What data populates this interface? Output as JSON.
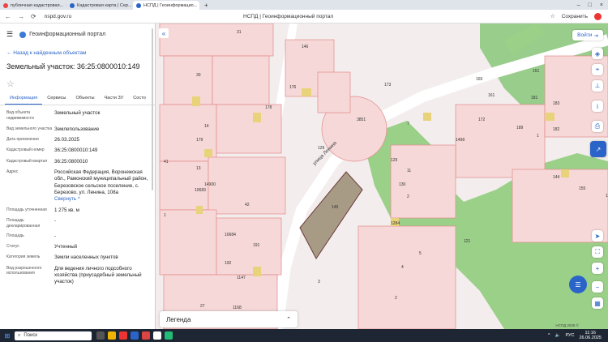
{
  "browser": {
    "tabs": [
      {
        "title": "публичная кадастровая...",
        "color": "#e44"
      },
      {
        "title": "Кадастровая карта | Сер...",
        "color": "#2a64c8"
      },
      {
        "title": "НСПД | Геоинформацио...",
        "color": "#2a64c8",
        "active": true
      }
    ],
    "new_tab": "+",
    "url": "nspd.gov.ru",
    "page_title": "НСПД | Геоинформационный портал",
    "save_label": "Сохранить",
    "nav": {
      "back": "←",
      "forward": "→",
      "reload": "⟳",
      "home": "⌂"
    }
  },
  "sidebar": {
    "portal_name": "Геоинформационный портал",
    "back_link": "← Назад к найденным объектам",
    "title": "Земельный участок: 36:25:0800010:149",
    "tabs": [
      "Информация",
      "Сервисы",
      "Объекты",
      "Части ЗУ",
      "Состо"
    ],
    "rows": [
      {
        "k": "Вид объекта недвижимости",
        "v": "Земельный участок"
      },
      {
        "k": "Вид земельного участка",
        "v": "Землепользование"
      },
      {
        "k": "Дата присвоения",
        "v": "26.03.2025"
      },
      {
        "k": "Кадастровый номер",
        "v": "36:25:0800010:149"
      },
      {
        "k": "Кадастровый квартал",
        "v": "36:25:0800010"
      },
      {
        "k": "Адрес",
        "v": "Российская Федерация, Воронежская обл., Рамонский муниципальный район, Березовское сельское поселение, с. Березово, ул. Ленина, 108а"
      },
      {
        "k": "Площадь уточненная",
        "v": "1 275 кв. м"
      },
      {
        "k": "Площадь декларированная",
        "v": "-"
      },
      {
        "k": "Площадь",
        "v": "-"
      },
      {
        "k": "Статус",
        "v": "Учтенный"
      },
      {
        "k": "Категория земель",
        "v": "Земли населенных пунктов"
      },
      {
        "k": "Вид разрешенного использования",
        "v": "Для ведения личного подсобного хозяйства (приусадебный земельный участок)"
      }
    ],
    "collapse_link": "Свернуть ^"
  },
  "map": {
    "login_label": "Войти",
    "legend_label": "Легенда",
    "copyright": "НСПД 2025 ©",
    "street_label": "улица Ленина",
    "plot_numbers": [
      "31",
      "30",
      "146",
      "176",
      "178",
      "179",
      "14",
      "13",
      "41",
      "14900",
      "10683",
      "1",
      "42",
      "10684",
      "191",
      "192",
      "129",
      "27",
      "1168",
      "149",
      "3851",
      "173",
      "7",
      "129",
      "11",
      "130",
      "2",
      "5",
      "4",
      "8",
      "3",
      "2",
      "151",
      "1",
      "144",
      "155",
      "156",
      "12",
      "161",
      "165",
      "172",
      "183",
      "182",
      "181",
      "1498",
      "189",
      "121",
      "1147",
      "1284"
    ]
  },
  "taskbar": {
    "search_placeholder": "Поиск",
    "lang": "РУС",
    "time": "11:16",
    "date": "26.06.2025"
  },
  "colors": {
    "accent": "#2a64c8",
    "parcel_fill": "#f6d8d8",
    "parcel_line": "#e38a8a",
    "green": "#8fc97f",
    "selected": "#a89b86"
  }
}
